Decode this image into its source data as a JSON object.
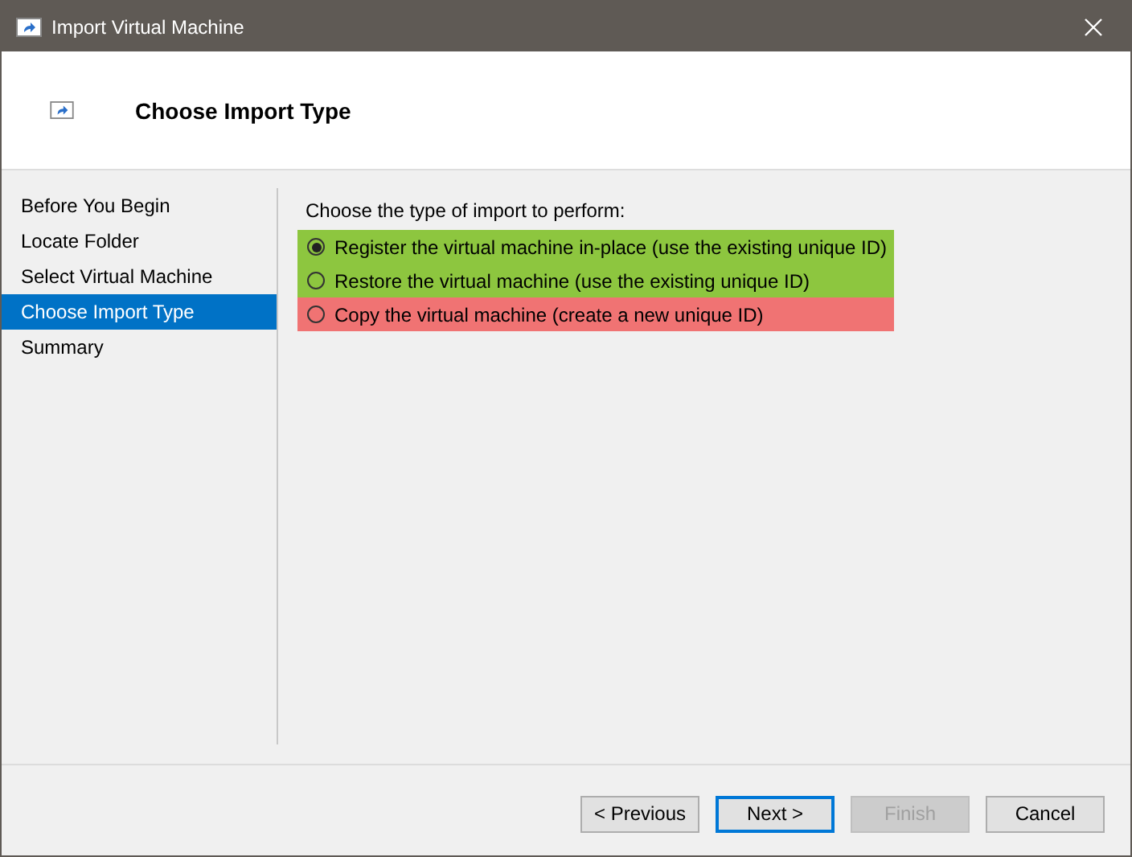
{
  "window": {
    "title": "Import Virtual Machine"
  },
  "header": {
    "title": "Choose Import Type"
  },
  "sidebar": {
    "items": [
      {
        "label": "Before You Begin",
        "selected": false
      },
      {
        "label": "Locate Folder",
        "selected": false
      },
      {
        "label": "Select Virtual Machine",
        "selected": false
      },
      {
        "label": "Choose Import Type",
        "selected": true
      },
      {
        "label": "Summary",
        "selected": false
      }
    ]
  },
  "content": {
    "prompt": "Choose the type of import to perform:",
    "options": [
      {
        "label": "Register the virtual machine in-place (use the existing unique ID)",
        "selected": true,
        "color": "#8dc63f"
      },
      {
        "label": "Restore the virtual machine (use the existing unique ID)",
        "selected": false,
        "color": "#8dc63f"
      },
      {
        "label": "Copy the virtual machine (create a new unique ID)",
        "selected": false,
        "color": "#f07373"
      }
    ]
  },
  "buttons": [
    {
      "label": "< Previous",
      "disabled": false,
      "default": false
    },
    {
      "label": "Next >",
      "disabled": false,
      "default": true
    },
    {
      "label": "Finish",
      "disabled": true,
      "default": false
    },
    {
      "label": "Cancel",
      "disabled": false,
      "default": false
    }
  ]
}
